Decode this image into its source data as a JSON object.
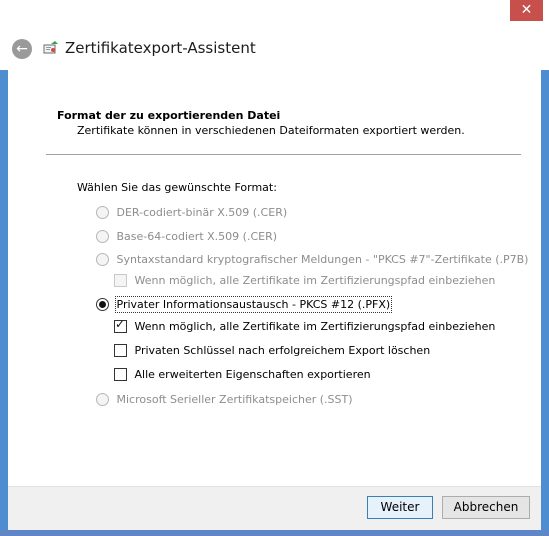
{
  "window": {
    "title": "Zertifikatexport-Assistent",
    "close_label": "✕",
    "back_icon": "back-arrow-icon",
    "app_icon": "certificate-export-icon",
    "accent_color": "#4d8dd0"
  },
  "section": {
    "title": "Format der zu exportierenden Datei",
    "subtitle": "Zertifikate können in verschiedenen Dateiformaten exportiert werden."
  },
  "format": {
    "prompt": "Wählen Sie das gewünschte Format:",
    "options": {
      "der": {
        "label": "DER-codiert-binär X.509 (.CER)",
        "enabled": false,
        "selected": false
      },
      "base64": {
        "label": "Base-64-codiert X.509 (.CER)",
        "enabled": false,
        "selected": false
      },
      "pkcs7": {
        "label": "Syntaxstandard kryptografischer Meldungen - \"PKCS #7\"-Zertifikate (.P7B)",
        "enabled": false,
        "selected": false
      },
      "pkcs7_include": {
        "label": "Wenn möglich, alle Zertifikate im Zertifizierungspfad einbeziehen",
        "enabled": false,
        "checked": false
      },
      "pfx": {
        "label": "Privater Informationsaustausch - PKCS #12 (.PFX)",
        "enabled": true,
        "selected": true
      },
      "pfx_include": {
        "label": "Wenn möglich, alle Zertifikate im Zertifizierungspfad einbeziehen",
        "enabled": true,
        "checked": true
      },
      "pfx_delete_key": {
        "label": "Privaten Schlüssel nach erfolgreichem Export löschen",
        "enabled": true,
        "checked": false
      },
      "pfx_export_props": {
        "label": "Alle erweiterten Eigenschaften exportieren",
        "enabled": true,
        "checked": false
      },
      "sst": {
        "label": "Microsoft Serieller Zertifikatspeicher (.SST)",
        "enabled": false,
        "selected": false
      }
    }
  },
  "buttons": {
    "next": "Weiter",
    "cancel": "Abbrechen"
  }
}
